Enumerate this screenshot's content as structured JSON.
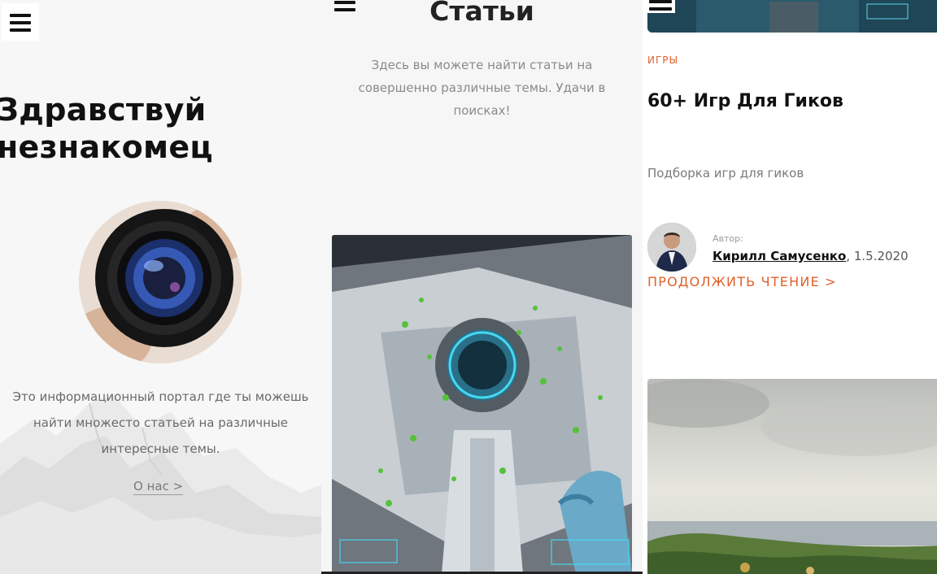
{
  "left_panel": {
    "hero_title_line1": "Здравствуй",
    "hero_title_line2": "незнакомец",
    "intro_line1": "Это информационный портал где ты можешь",
    "intro_line2": "найти множесто статьей на различные",
    "intro_line3": "интересные темы.",
    "about_link": "О нас >"
  },
  "middle_panel": {
    "title": "Статьи",
    "description_line1": "Здесь вы можете найти статьи на",
    "description_line2": "совершенно различные темы. Удачи в",
    "description_line3": "поисках!"
  },
  "right_panel": {
    "category": "ИГРЫ",
    "article_title": "60+ Игр Для Гиков",
    "article_subtitle": "Подборка игр для гиков",
    "author_label": "Автор:",
    "author_name": "Кирилл Самусенко",
    "date_text": ", 1.5.2020",
    "read_more": "ПРОДОЛЖИТЬ ЧТЕНИЕ >"
  },
  "colors": {
    "accent": "#e0602a",
    "text_dark": "#111111",
    "text_muted": "#7a7a7a"
  },
  "icons": [
    "menu-icon"
  ]
}
